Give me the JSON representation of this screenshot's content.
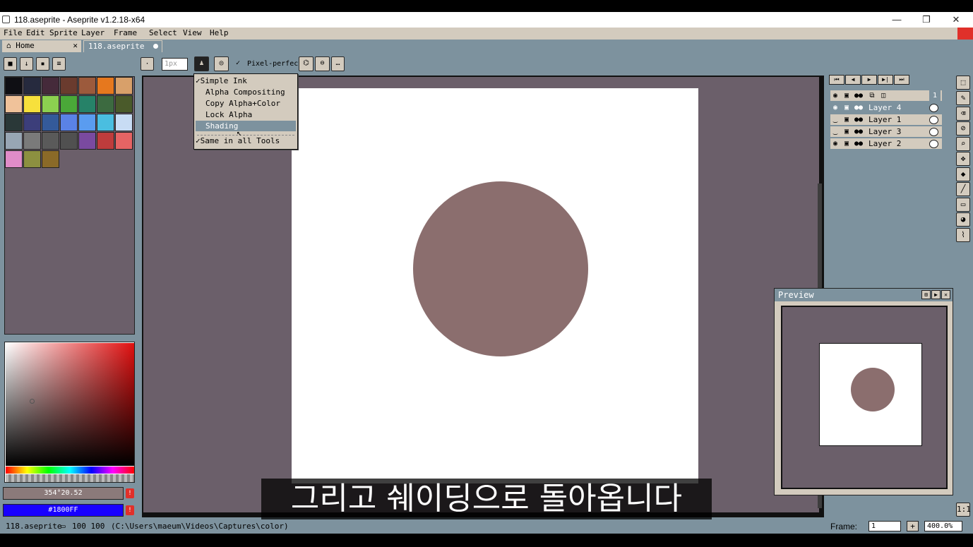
{
  "window": {
    "title": "118.aseprite - Aseprite v1.2.18-x64",
    "minimize": "—",
    "restore": "❐",
    "close": "✕"
  },
  "menu": [
    "File",
    "Edit",
    "Sprite",
    "Layer",
    "Frame",
    "Select",
    "View",
    "Help"
  ],
  "tabs": [
    {
      "label": "Home",
      "close": "✕"
    },
    {
      "label": "118.aseprite"
    }
  ],
  "toolbar": {
    "brush_size": "1px",
    "pixel_perfect": "Pixel-perfect"
  },
  "ink_menu": {
    "items": [
      "Simple Ink",
      "Alpha Compositing",
      "Copy Alpha+Color",
      "Lock Alpha",
      "Shading",
      "Same in all Tools"
    ],
    "checked": [
      "Simple Ink",
      "Same in all Tools"
    ],
    "selected": "Shading"
  },
  "palette": {
    "colors": [
      "#0f0f14",
      "#262a3e",
      "#452a3a",
      "#6a3b2e",
      "#9c5a3c",
      "#e6781e",
      "#d8a06a",
      "#f0c29a",
      "#f7e03c",
      "#8cd050",
      "#4aa838",
      "#268268",
      "#3c6a40",
      "#4a5a2a",
      "#2a3838",
      "#3c3e7a",
      "#345a9a",
      "#5a82e6",
      "#5a9cf0",
      "#4abee0",
      "#c8dcf4",
      "#98a6b4",
      "#7a7a7a",
      "#5a5a5a",
      "#505050",
      "#7a4aa0",
      "#be3c3c",
      "#e66464",
      "#e08cc8",
      "#8c9040",
      "#8a6a28"
    ]
  },
  "color_fields": {
    "foreground": "354°20.52",
    "background": "#1800FF",
    "warn": "!"
  },
  "frame_controls": [
    "⏮",
    "◀",
    "▶",
    "▶|",
    "⏭"
  ],
  "layers": {
    "header_frame": "1",
    "items": [
      {
        "name": "Layer 4",
        "visible": true,
        "active": true
      },
      {
        "name": "Layer 1",
        "visible": false,
        "active": false
      },
      {
        "name": "Layer 3",
        "visible": false,
        "active": false
      },
      {
        "name": "Layer 2",
        "visible": true,
        "active": false
      }
    ]
  },
  "preview": {
    "title": "Preview"
  },
  "status": {
    "filename": "118.aseprite",
    "size": "100 100",
    "path": "(C:\\Users\\maeum\\Videos\\Captures\\color)",
    "frame_label": "Frame:",
    "frame_value": "1",
    "zoom": "400.0%",
    "add": "+"
  },
  "subtitle": "그리고 쉐이딩으로 돌아옵니다",
  "colors": {
    "ui": "#d3cbbe",
    "panel": "#7d929e",
    "canvas_bg": "#6b5f6a",
    "circle": "#8b6e6e",
    "accent": "#e0302a"
  }
}
